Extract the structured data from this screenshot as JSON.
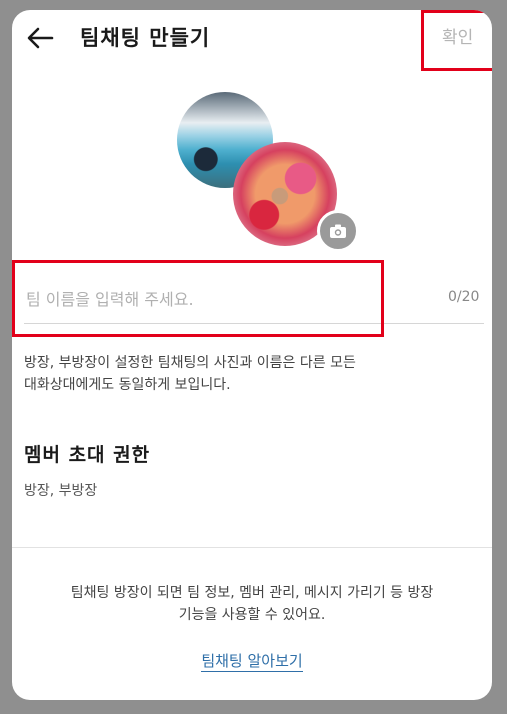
{
  "header": {
    "title": "팀채팅 만들기",
    "confirm_label": "확인",
    "back_icon": "arrow-left-icon"
  },
  "profile": {
    "camera_icon": "camera-icon"
  },
  "name_field": {
    "placeholder": "팀 이름을 입력해 주세요.",
    "value": "",
    "char_count": "0/20"
  },
  "notice": {
    "line1": "방장, 부방장이 설정한 팀채팅의 사진과 이름은 다른 모든",
    "line2": "대화상대에게도 동일하게 보입니다."
  },
  "member_invite": {
    "title": "멤버 초대 권한",
    "value": "방장, 부방장"
  },
  "footer": {
    "line1": "팀채팅 방장이 되면 팀 정보, 멤버 관리, 메시지 가리기 등 방장",
    "line2": "기능을 사용할 수 있어요.",
    "link_label": "팀채팅 알아보기"
  },
  "colors": {
    "highlight": "#e2001a",
    "link": "#2f6fa8",
    "confirm_disabled": "#b5b5b5"
  }
}
